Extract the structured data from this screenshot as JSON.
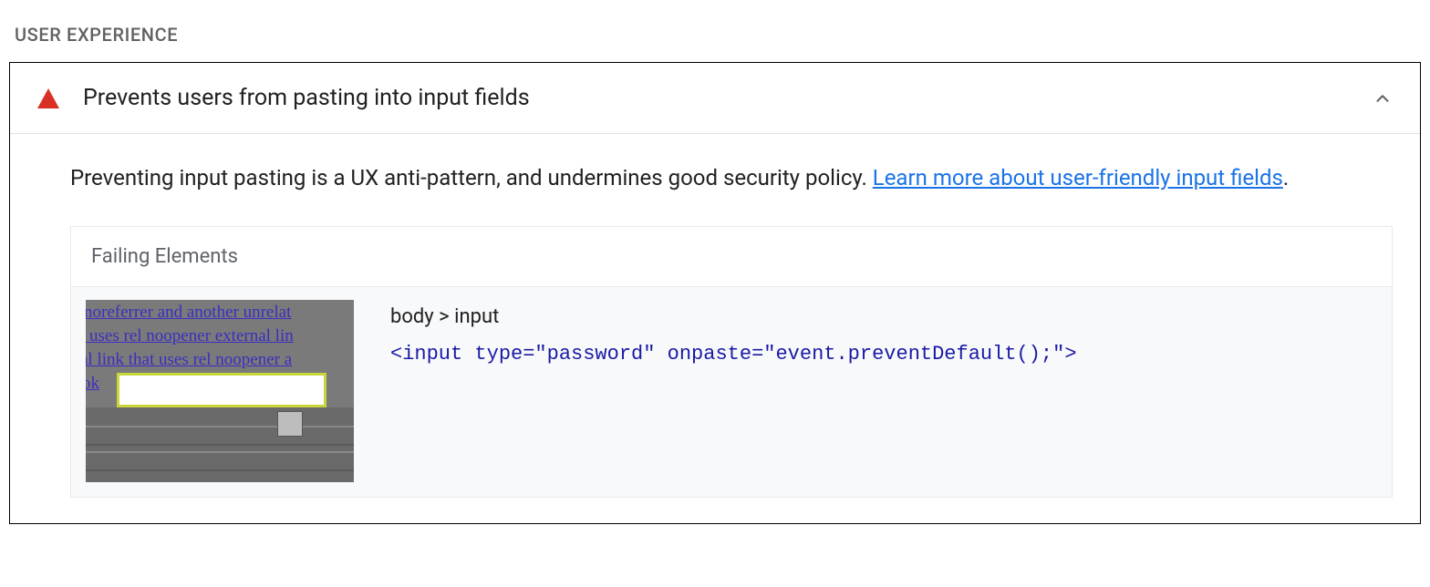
{
  "section": {
    "label": "USER EXPERIENCE"
  },
  "audit": {
    "title": "Prevents users from pasting into input fields",
    "description_text": "Preventing input pasting is a UX anti-pattern, and undermines good security policy. ",
    "learn_more_text": "Learn more about user-friendly input fields",
    "period": ".",
    "status": "fail",
    "expanded": true
  },
  "failing": {
    "header": "Failing Elements",
    "element": {
      "selector_path": "body > input",
      "snippet": "<input type=\"password\" onpaste=\"event.preventDefault();\">"
    },
    "thumbnail": {
      "line1": "  noreferrer and another unrelat",
      "line2": "t uses rel noopener external lin",
      "line3": "al link that uses rel noopener a",
      "ok": " ok"
    }
  }
}
